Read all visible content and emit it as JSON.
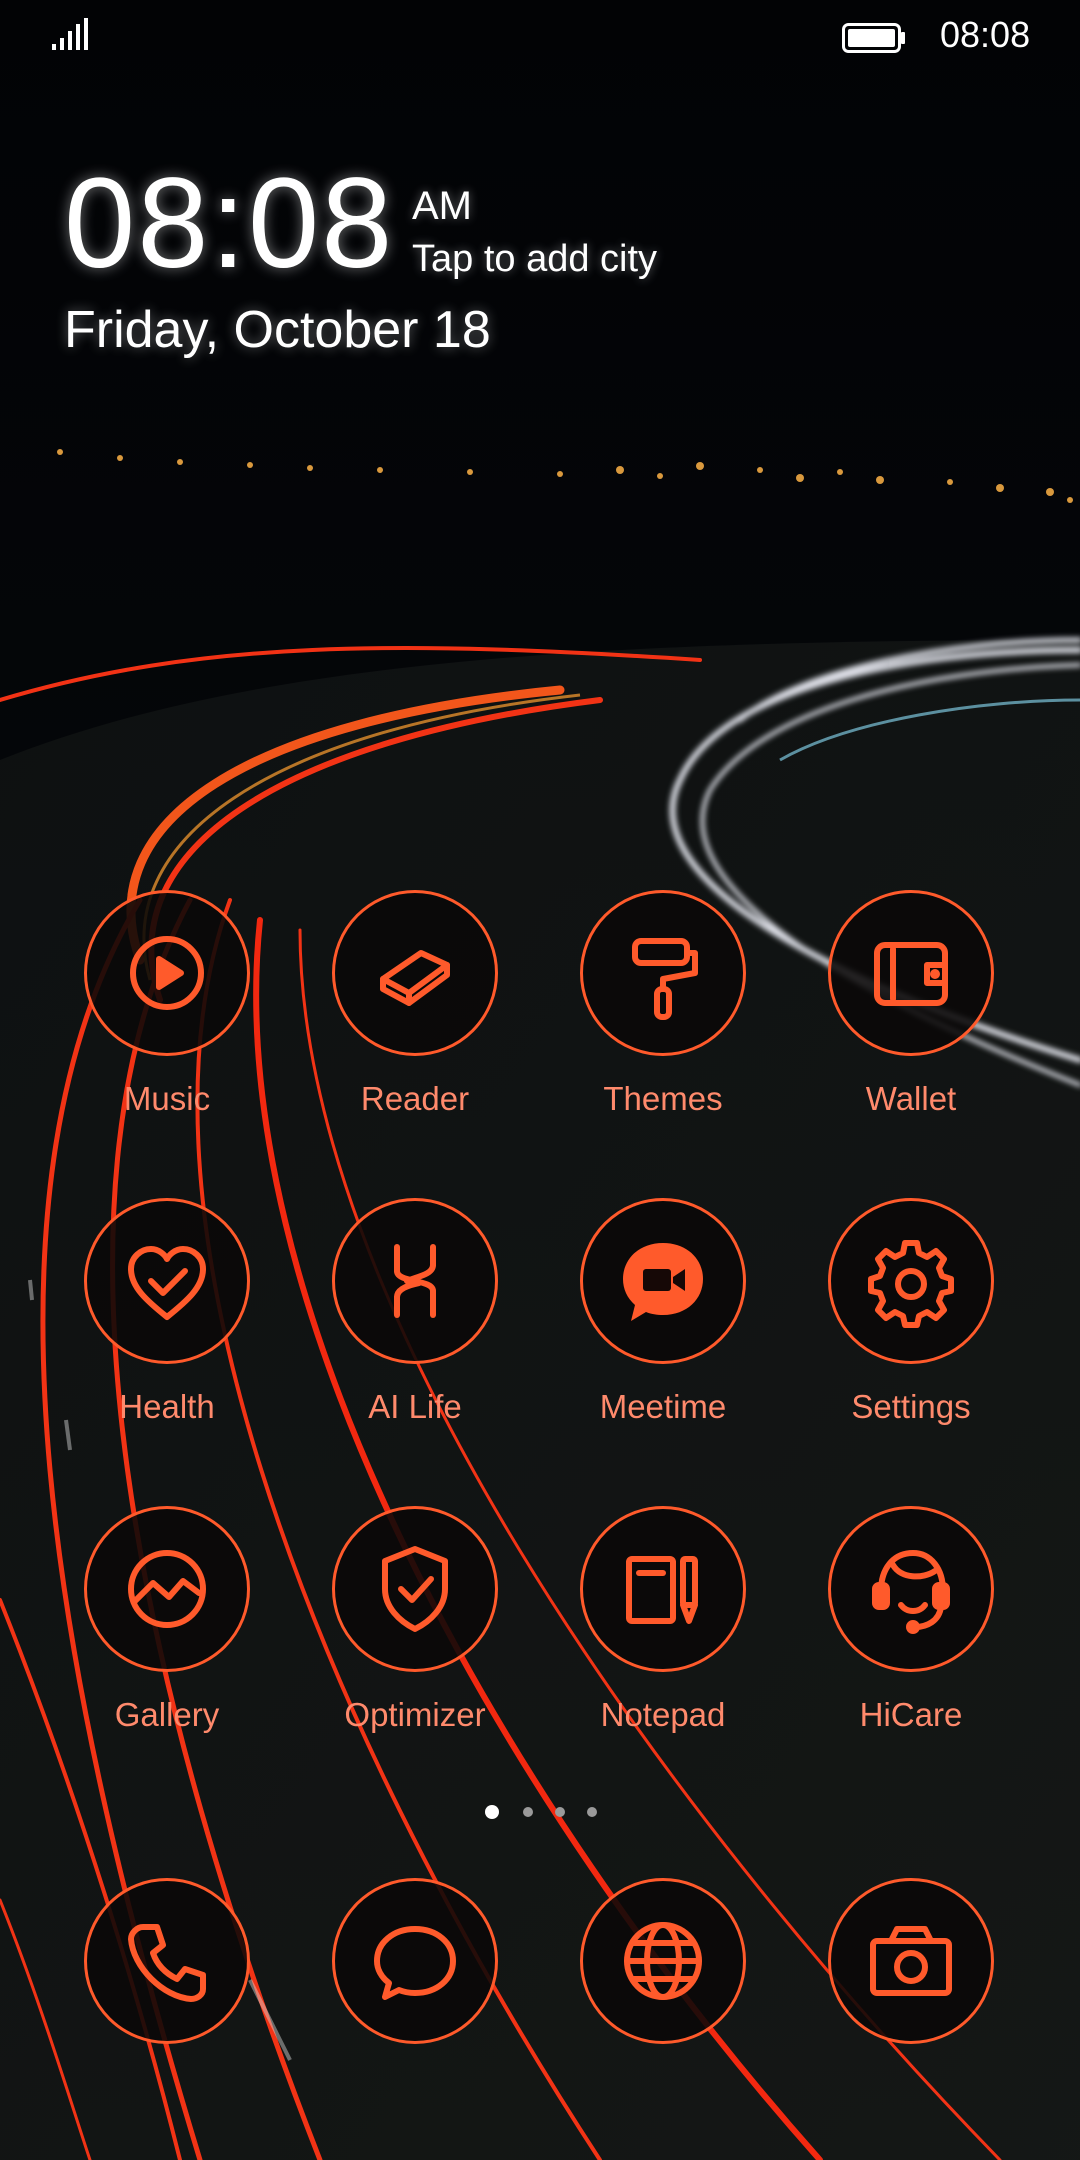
{
  "status_bar": {
    "time": "08:08"
  },
  "clock_widget": {
    "time": "08:08",
    "ampm": "AM",
    "city_prompt": "Tap to add city",
    "date": "Friday, October 18"
  },
  "apps": [
    {
      "label": "Music",
      "icon": "music-play-icon"
    },
    {
      "label": "Reader",
      "icon": "book-icon"
    },
    {
      "label": "Themes",
      "icon": "paint-roller-icon"
    },
    {
      "label": "Wallet",
      "icon": "wallet-icon"
    },
    {
      "label": "Health",
      "icon": "heart-check-icon"
    },
    {
      "label": "AI Life",
      "icon": "ai-life-icon"
    },
    {
      "label": "Meetime",
      "icon": "video-chat-icon"
    },
    {
      "label": "Settings",
      "icon": "gear-icon"
    },
    {
      "label": "Gallery",
      "icon": "gallery-icon"
    },
    {
      "label": "Optimizer",
      "icon": "shield-check-icon"
    },
    {
      "label": "Notepad",
      "icon": "notepad-icon"
    },
    {
      "label": "HiCare",
      "icon": "headset-icon"
    }
  ],
  "dock": [
    {
      "icon": "phone-icon"
    },
    {
      "icon": "message-icon"
    },
    {
      "icon": "browser-globe-icon"
    },
    {
      "icon": "camera-icon"
    }
  ],
  "pages": {
    "count": 4,
    "active": 1
  },
  "theme": {
    "accent": "#ff5a2b",
    "label_color": "#ff8a6c"
  }
}
